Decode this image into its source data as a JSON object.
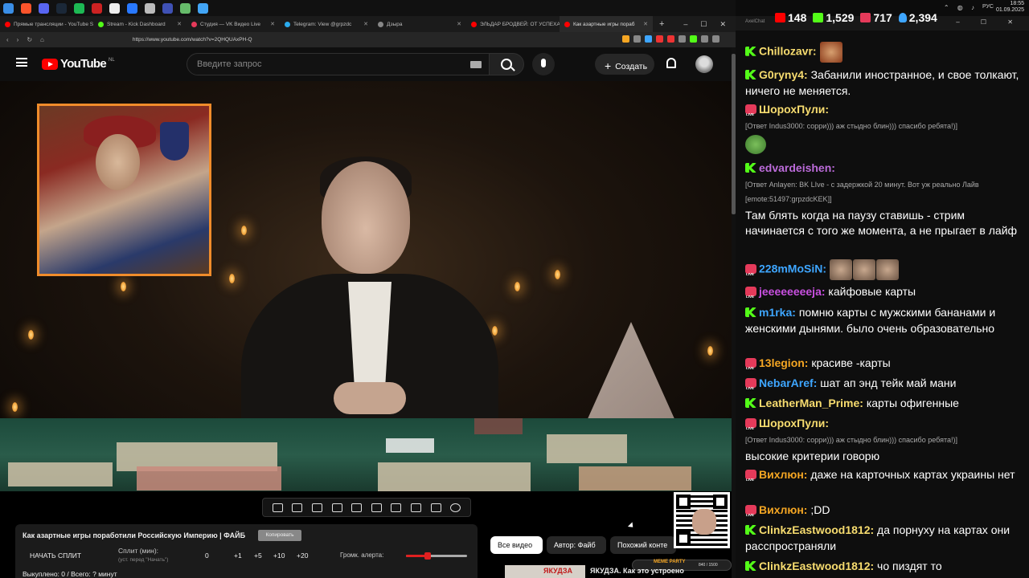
{
  "taskbar": {
    "icons": [
      {
        "name": "start-icon",
        "color": "#3a8ee6"
      },
      {
        "name": "brave-icon",
        "color": "#fb542b"
      },
      {
        "name": "discord-icon",
        "color": "#5865f2"
      },
      {
        "name": "steam-icon",
        "color": "#1b2838"
      },
      {
        "name": "spotify-icon",
        "color": "#1db954"
      },
      {
        "name": "app-icon",
        "color": "#cc2222"
      },
      {
        "name": "app-icon-2",
        "color": "#eeeeee"
      },
      {
        "name": "app-icon-3",
        "color": "#2979ff"
      },
      {
        "name": "app-icon-4",
        "color": "#bbbbbb"
      },
      {
        "name": "app-icon-5",
        "color": "#3f51b5"
      },
      {
        "name": "app-icon-6",
        "color": "#66bb6a"
      },
      {
        "name": "app-icon-7",
        "color": "#42a5f5"
      }
    ],
    "lang": "РУС",
    "time": "18:55",
    "date": "01.09.2025"
  },
  "browser": {
    "tabs": [
      {
        "label": "Прямые трансляции - YouTube S",
        "color": "#ff0000",
        "active": false
      },
      {
        "label": "Stream - Kick Dashboard",
        "color": "#53fc18",
        "active": false
      },
      {
        "label": "Студия — VK Видео Live",
        "color": "#e53a5a",
        "active": false
      },
      {
        "label": "Telegram: View @grpzdc",
        "color": "#2aabee",
        "active": false
      },
      {
        "label": "Дзыра",
        "color": "#888888",
        "active": false
      },
      {
        "label": "ЭЛЬДАР БРОДВЕЙ: ОТ УСПЕХА",
        "color": "#ff0000",
        "active": false
      },
      {
        "label": "Как азартные игры пораб",
        "color": "#ff0000",
        "active": true
      }
    ],
    "url": "https://www.youtube.com/watch?v=2QHQUAxPH-Q"
  },
  "youtube": {
    "logo": "YouTube",
    "region": "NL",
    "search_placeholder": "Введите запрос",
    "create_label": "Создать"
  },
  "panel": {
    "video_title": "Как азартные игры поработили Российскую Империю | ФАЙБ",
    "copy_label": "Копировать",
    "start_split": "НАЧАТЬ СПЛИТ",
    "split_label": "Сплит (мин):",
    "split_sub": "(уст. перед \"Начать\")",
    "split_value": "0",
    "inc": [
      "+1",
      "+5",
      "+10",
      "+20"
    ],
    "alert_label": "Громк. алерта:",
    "alert_volume": 0.35,
    "bought": "Выкуплено: 0 / Всего: ? минут"
  },
  "chips": [
    {
      "label": "Все видео",
      "active": true
    },
    {
      "label": "Автор: Файб",
      "active": false
    },
    {
      "label": "Похожий конте",
      "active": false
    }
  ],
  "meme": {
    "label": "MEME PARTY",
    "count": "840 / 1500"
  },
  "recommended": {
    "thumb_text": "ЯКУДЗА",
    "title": "ЯКУДЗА. Как это устроено"
  },
  "chat": {
    "window_title": "AxelChat",
    "stats": [
      {
        "icon": "youtube-icon",
        "color": "#ff0000",
        "value": "148"
      },
      {
        "icon": "kick-icon",
        "color": "#53fc18",
        "value": "1,529"
      },
      {
        "icon": "vk-live-icon",
        "color": "#e53a5a",
        "value": "717"
      },
      {
        "icon": "viewers-icon",
        "color": "#3ea6ff",
        "value": "2,394"
      }
    ],
    "messages": [
      {
        "platform": "kick",
        "user": "Chillozavr:",
        "color": "#f7dc6f",
        "text": "",
        "reply": "",
        "emote": true
      },
      {
        "platform": "kick",
        "user": "G0ryny4:",
        "color": "#f7dc6f",
        "text": "Забанили иностранное, и свое толкают, ничего не меняется.",
        "reply": ""
      },
      {
        "platform": "vk",
        "user": "ШорохПули:",
        "color": "#f7dc6f",
        "text": "",
        "reply": "[Ответ Indus3000: сорри))) аж стыдно блин))) спасибо ребята!)]",
        "pepe": true
      },
      {
        "platform": "kick",
        "user": "edvardeishen:",
        "color": "#bb6bd9",
        "text": "Там блять когда на паузу ставишь - стрим начинается с того же момента, а не прыгает в лайф",
        "reply": "[Ответ Anlayen: BK LIve - с задержкой 20 минут. Вот уж реально Лайв",
        "reply2": "[emote:51497:grpzdcKEK]]"
      },
      {
        "platform": "vk",
        "user": "228mMoSiN:",
        "color": "#3ea6ff",
        "text": "",
        "reply": "",
        "emotes": 3
      },
      {
        "platform": "vk",
        "user": "jeeeeeeeeja:",
        "color": "#c850e0",
        "text": "кайфовые карты",
        "reply": ""
      },
      {
        "platform": "kick",
        "user": "m1rka:",
        "color": "#3ea6ff",
        "text": "помню карты с мужскими бананами и женскими дынями. было очень образовательно",
        "reply": ""
      },
      {
        "platform": "vk",
        "user": "13legion:",
        "color": "#f5a623",
        "text": "красиве -карты",
        "reply": ""
      },
      {
        "platform": "vk",
        "user": "NebarAref:",
        "color": "#3ea6ff",
        "text": "шат ап энд тейк май мани",
        "reply": ""
      },
      {
        "platform": "kick",
        "user": "LeatherMan_Prime:",
        "color": "#f7dc6f",
        "text": "карты офигенные",
        "reply": ""
      },
      {
        "platform": "vk",
        "user": "ШорохПули:",
        "color": "#f7dc6f",
        "text": "высокие критерии говорю",
        "reply": "[Ответ Indus3000: сорри))) аж стыдно блин))) спасибо ребята!)]"
      },
      {
        "platform": "vk",
        "user": "Вихлюн:",
        "color": "#f5a623",
        "text": "даже на карточных картах украины нет",
        "reply": ""
      },
      {
        "platform": "vk",
        "user": "Вихлюн:",
        "color": "#f5a623",
        "text": ";DD",
        "reply": ""
      },
      {
        "platform": "kick",
        "user": "ClinkzEastwood1812:",
        "color": "#f7dc6f",
        "text": "да порнуху на картах они расспространяли",
        "reply": ""
      },
      {
        "platform": "kick",
        "user": "ClinkzEastwood1812:",
        "color": "#f7dc6f",
        "text": "чо пиздят то",
        "reply": ""
      }
    ]
  }
}
